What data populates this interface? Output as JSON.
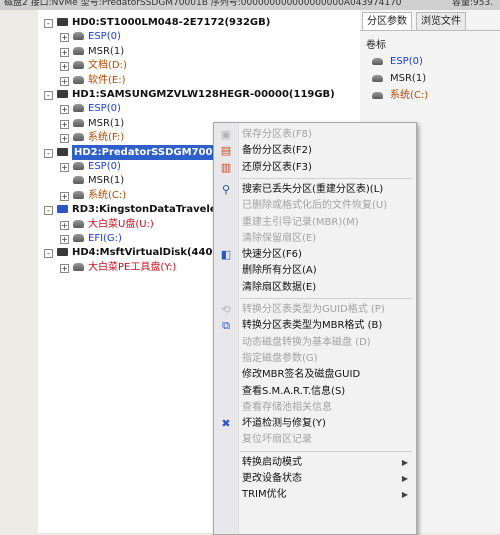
{
  "title_bar": {
    "text_left": "磁盘2 接口:NVMe  型号:PredatorSSDGM70001B  序列号:000000000000000000A043974170",
    "text_right": "容量:953."
  },
  "tree": {
    "rows": [
      {
        "label": "HD0:ST1000LM048-2E7172(932GB)",
        "kind": "disk",
        "level": 0,
        "expander": "-"
      },
      {
        "label": "ESP(0)",
        "kind": "vol",
        "color": "blue",
        "level": 1,
        "expander": "+"
      },
      {
        "label": "MSR(1)",
        "kind": "vol",
        "color": "black",
        "level": 1,
        "expander": "+"
      },
      {
        "label": "文档(D:)",
        "kind": "vol",
        "color": "brown",
        "level": 1,
        "expander": "+"
      },
      {
        "label": "软件(E:)",
        "kind": "vol",
        "color": "brown",
        "level": 1,
        "expander": "+"
      },
      {
        "label": "HD1:SAMSUNGMZVLW128HEGR-00000(119GB)",
        "kind": "disk",
        "level": 0,
        "expander": "-"
      },
      {
        "label": "ESP(0)",
        "kind": "vol",
        "color": "blue",
        "level": 1,
        "expander": "+"
      },
      {
        "label": "MSR(1)",
        "kind": "vol",
        "color": "black",
        "level": 1,
        "expander": "+"
      },
      {
        "label": "系统(F:)",
        "kind": "vol",
        "color": "brown",
        "level": 1,
        "expander": "+"
      },
      {
        "label": "HD2:PredatorSSDGM70001B",
        "kind": "disk",
        "level": 0,
        "expander": "-",
        "selected": true
      },
      {
        "label": "ESP(0)",
        "kind": "vol",
        "color": "blue",
        "level": 1,
        "expander": "+"
      },
      {
        "label": "MSR(1)",
        "kind": "vol",
        "color": "black",
        "level": 1,
        "expander": ""
      },
      {
        "label": "系统(C:)",
        "kind": "vol",
        "color": "brown",
        "level": 1,
        "expander": "+"
      },
      {
        "label": "RD3:KingstonDataTraveler3.",
        "kind": "usb",
        "level": 0,
        "expander": "-"
      },
      {
        "label": "大白菜U盘(U:)",
        "kind": "vol",
        "color": "red",
        "level": 1,
        "expander": "+"
      },
      {
        "label": "EFI(G:)",
        "kind": "vol",
        "color": "blue",
        "level": 1,
        "expander": "+"
      },
      {
        "label": "HD4:MsftVirtualDisk(440MB)",
        "kind": "disk",
        "level": 0,
        "expander": "-"
      },
      {
        "label": "大白菜PE工具盘(Y:)",
        "kind": "vol",
        "color": "red",
        "level": 1,
        "expander": "+"
      }
    ]
  },
  "right_pane": {
    "tabs": [
      "分区参数",
      "浏览文件"
    ],
    "header": "卷标",
    "items": [
      {
        "label": "ESP(0)",
        "color": "blue"
      },
      {
        "label": "MSR(1)",
        "color": "black"
      },
      {
        "label": "系统(C:)",
        "color": "brown"
      }
    ]
  },
  "context_menu": {
    "items": [
      {
        "label": "保存分区表(F8)",
        "enabled": false,
        "icon": "save-icon"
      },
      {
        "label": "备份分区表(F2)",
        "enabled": true,
        "icon": "backup-icon"
      },
      {
        "label": "还原分区表(F3)",
        "enabled": true,
        "icon": "restore-icon"
      },
      {
        "sep": true
      },
      {
        "label": "搜索已丢失分区(重建分区表)(L)",
        "enabled": true,
        "icon": "search-icon"
      },
      {
        "label": "已删除或格式化后的文件恢复(U)",
        "enabled": false,
        "icon": ""
      },
      {
        "label": "重建主引导记录(MBR)(M)",
        "enabled": false,
        "icon": ""
      },
      {
        "label": "清除保留扇区(E)",
        "enabled": false,
        "icon": ""
      },
      {
        "label": "快速分区(F6)",
        "enabled": true,
        "icon": "quick-partition-icon"
      },
      {
        "label": "删除所有分区(A)",
        "enabled": true,
        "icon": ""
      },
      {
        "label": "清除扇区数据(E)",
        "enabled": true,
        "icon": ""
      },
      {
        "sep": true
      },
      {
        "label": "转换分区表类型为GUID格式 (P)",
        "enabled": false,
        "icon": "convert-icon"
      },
      {
        "label": "转换分区表类型为MBR格式 (B)",
        "enabled": true,
        "icon": "convert-mbr-icon"
      },
      {
        "label": "动态磁盘转换为基本磁盘 (D)",
        "enabled": false,
        "icon": ""
      },
      {
        "label": "指定磁盘参数(G)",
        "enabled": false,
        "icon": ""
      },
      {
        "label": "修改MBR签名及磁盘GUID",
        "enabled": true,
        "icon": ""
      },
      {
        "label": "查看S.M.A.R.T.信息(S)",
        "enabled": true,
        "icon": ""
      },
      {
        "label": "查看存储池相关信息",
        "enabled": false,
        "icon": ""
      },
      {
        "label": "坏道检测与修复(Y)",
        "enabled": true,
        "icon": "repair-icon"
      },
      {
        "label": "复位坏扇区记录",
        "enabled": false,
        "icon": ""
      },
      {
        "sep": true
      },
      {
        "label": "转换启动模式",
        "enabled": true,
        "icon": "",
        "submenu": true
      },
      {
        "label": "更改设备状态",
        "enabled": true,
        "icon": "",
        "submenu": true
      },
      {
        "label": "TRIM优化",
        "enabled": true,
        "icon": "",
        "submenu": true
      }
    ]
  },
  "colors": {
    "blue": "#1a3cd6",
    "brown": "#b24a00",
    "red": "#c8101e",
    "selection": "#2f5fc8"
  }
}
